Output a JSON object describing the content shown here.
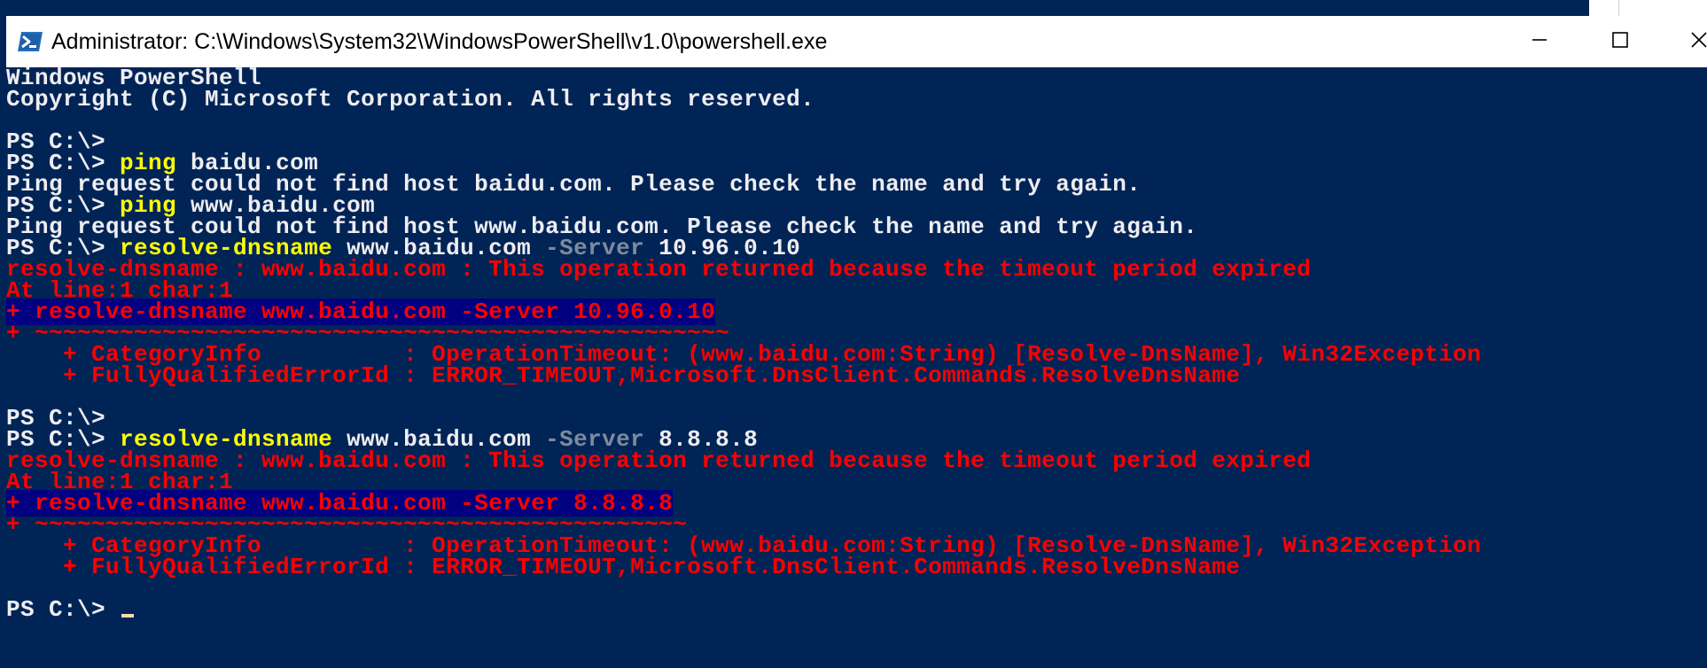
{
  "window": {
    "title": "Administrator: C:\\Windows\\System32\\WindowsPowerShell\\v1.0\\powershell.exe",
    "icon": "powershell-icon",
    "controls": {
      "minimize": "minimize-icon",
      "maximize": "maximize-icon",
      "close": "close-icon"
    }
  },
  "colors": {
    "background": "#012456",
    "text": "#eeedf0",
    "command": "#ffff00",
    "parameter": "#7f8a9c",
    "error": "#ff0000",
    "cursor": "#fedba9"
  },
  "console": {
    "lines": [
      {
        "kind": "output",
        "segments": [
          {
            "t": "Windows PowerShell",
            "c": "w"
          }
        ]
      },
      {
        "kind": "output",
        "segments": [
          {
            "t": "Copyright (C) Microsoft Corporation. All rights reserved.",
            "c": "w"
          }
        ]
      },
      {
        "kind": "blank",
        "segments": []
      },
      {
        "kind": "prompt",
        "segments": [
          {
            "t": "PS C:\\>",
            "c": "w"
          }
        ]
      },
      {
        "kind": "prompt",
        "segments": [
          {
            "t": "PS C:\\> ",
            "c": "w"
          },
          {
            "t": "ping",
            "c": "y"
          },
          {
            "t": " baidu.com",
            "c": "w"
          }
        ]
      },
      {
        "kind": "output",
        "segments": [
          {
            "t": "Ping request could not find host baidu.com. Please check the name and try again.",
            "c": "w"
          }
        ]
      },
      {
        "kind": "prompt",
        "segments": [
          {
            "t": "PS C:\\> ",
            "c": "w"
          },
          {
            "t": "ping",
            "c": "y"
          },
          {
            "t": " www.baidu.com",
            "c": "w"
          }
        ]
      },
      {
        "kind": "output",
        "segments": [
          {
            "t": "Ping request could not find host www.baidu.com. Please check the name and try again.",
            "c": "w"
          }
        ]
      },
      {
        "kind": "prompt",
        "segments": [
          {
            "t": "PS C:\\> ",
            "c": "w"
          },
          {
            "t": "resolve-dnsname",
            "c": "y"
          },
          {
            "t": " www.baidu.com ",
            "c": "w"
          },
          {
            "t": "-Server",
            "c": "g"
          },
          {
            "t": " 10.96.0.10",
            "c": "w"
          }
        ]
      },
      {
        "kind": "error",
        "segments": [
          {
            "t": "resolve-dnsname : www.baidu.com : This operation returned because the timeout period expired",
            "c": "r"
          }
        ]
      },
      {
        "kind": "error",
        "segments": [
          {
            "t": "At line:1 char:1",
            "c": "r"
          }
        ]
      },
      {
        "kind": "error",
        "segments": [
          {
            "t": "+ resolve-dnsname www.baidu.com -Server 10.96.0.10",
            "c": "r"
          }
        ]
      },
      {
        "kind": "error",
        "segments": [
          {
            "t": "+ ~~~~~~~~~~~~~~~~~~~~~~~~~~~~~~~~~~~~~~~~~~~~~~~~~",
            "c": "r"
          }
        ]
      },
      {
        "kind": "error",
        "segments": [
          {
            "t": "    + CategoryInfo          : OperationTimeout: (www.baidu.com:String) [Resolve-DnsName], Win32Exception",
            "c": "r"
          }
        ]
      },
      {
        "kind": "error",
        "segments": [
          {
            "t": "    + FullyQualifiedErrorId : ERROR_TIMEOUT,Microsoft.DnsClient.Commands.ResolveDnsName",
            "c": "r"
          }
        ]
      },
      {
        "kind": "blank",
        "segments": []
      },
      {
        "kind": "prompt",
        "segments": [
          {
            "t": "PS C:\\>",
            "c": "w"
          }
        ]
      },
      {
        "kind": "prompt",
        "segments": [
          {
            "t": "PS C:\\> ",
            "c": "w"
          },
          {
            "t": "resolve-dnsname",
            "c": "y"
          },
          {
            "t": " www.baidu.com ",
            "c": "w"
          },
          {
            "t": "-Server",
            "c": "g"
          },
          {
            "t": " 8.8.8.8",
            "c": "w"
          }
        ]
      },
      {
        "kind": "error",
        "segments": [
          {
            "t": "resolve-dnsname : www.baidu.com : This operation returned because the timeout period expired",
            "c": "r"
          }
        ]
      },
      {
        "kind": "error",
        "segments": [
          {
            "t": "At line:1 char:1",
            "c": "r"
          }
        ]
      },
      {
        "kind": "error",
        "segments": [
          {
            "t": "+ resolve-dnsname www.baidu.com -Server 8.8.8.8",
            "c": "r"
          }
        ]
      },
      {
        "kind": "error",
        "segments": [
          {
            "t": "+ ~~~~~~~~~~~~~~~~~~~~~~~~~~~~~~~~~~~~~~~~~~~~~~",
            "c": "r"
          }
        ]
      },
      {
        "kind": "error",
        "segments": [
          {
            "t": "    + CategoryInfo          : OperationTimeout: (www.baidu.com:String) [Resolve-DnsName], Win32Exception",
            "c": "r"
          }
        ]
      },
      {
        "kind": "error",
        "segments": [
          {
            "t": "    + FullyQualifiedErrorId : ERROR_TIMEOUT,Microsoft.DnsClient.Commands.ResolveDnsName",
            "c": "r"
          }
        ]
      },
      {
        "kind": "blank",
        "segments": []
      },
      {
        "kind": "active-prompt",
        "segments": [
          {
            "t": "PS C:\\> ",
            "c": "w"
          }
        ]
      }
    ]
  }
}
